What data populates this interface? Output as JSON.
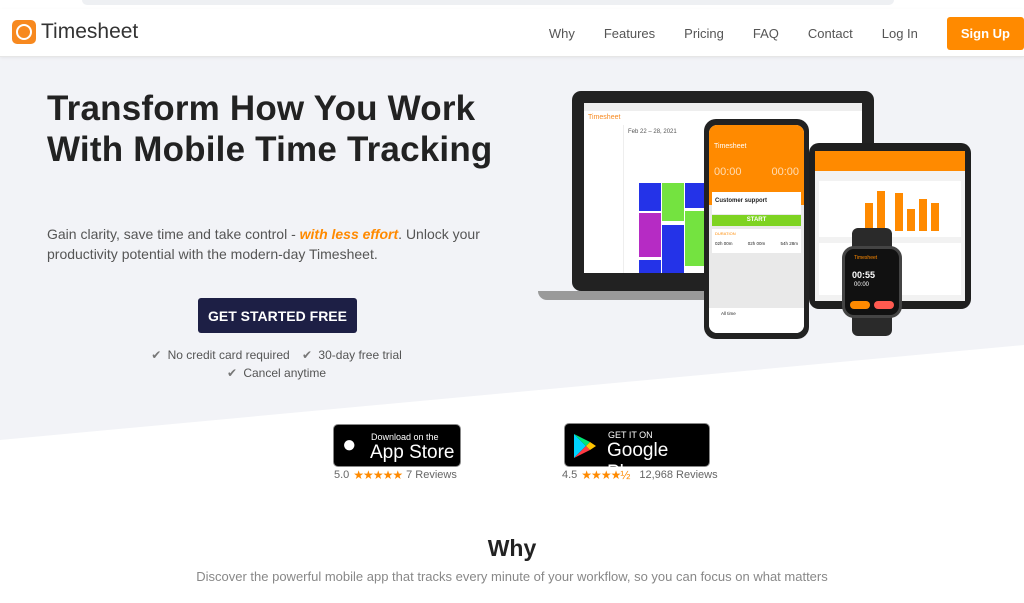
{
  "brand": {
    "name": "Timesheet",
    "accent": "#ff8a00",
    "navy": "#1d1f45"
  },
  "nav": {
    "items": [
      "Why",
      "Features",
      "Pricing",
      "FAQ",
      "Contact",
      "Log In"
    ],
    "signup": "Sign Up"
  },
  "hero": {
    "title": "Transform How You Work With Mobile Time Tracking",
    "subtitle_pre": "Gain clarity, save time and take control - ",
    "subtitle_em": "with less effort",
    "subtitle_post": ". Unlock your productivity potential with the modern-day Timesheet.",
    "cta": "GET STARTED FREE",
    "checks": [
      "No credit card required",
      "30-day free trial",
      "Cancel anytime"
    ]
  },
  "devices": {
    "laptop": {
      "app": "Timesheet",
      "date_range": "Feb 22 – 28, 2021"
    },
    "phone": {
      "app": "Timesheet",
      "timer": "00:00",
      "timer2": "00:00",
      "task": "Customer support",
      "start": "START",
      "duration_label": "DURATION",
      "durations": [
        "02h 00m",
        "02h 00m",
        "54h 28m"
      ],
      "footer": "All time"
    },
    "watch": {
      "app": "Timesheet",
      "time": "00:55",
      "time2": "00:00"
    }
  },
  "stores": {
    "appstore": {
      "small": "Download on the",
      "big": "App Store",
      "score": "5.0",
      "stars": "★★★★★",
      "reviews": "7 Reviews",
      "rating": 5.0
    },
    "googleplay": {
      "small": "GET IT ON",
      "big": "Google Play",
      "score": "4.5",
      "stars": "★★★★½",
      "reviews": "12,968 Reviews",
      "rating": 4.5
    }
  },
  "why": {
    "title": "Why",
    "subtitle": "Discover the powerful mobile app that tracks every minute of your workflow, so you can focus on what matters"
  }
}
